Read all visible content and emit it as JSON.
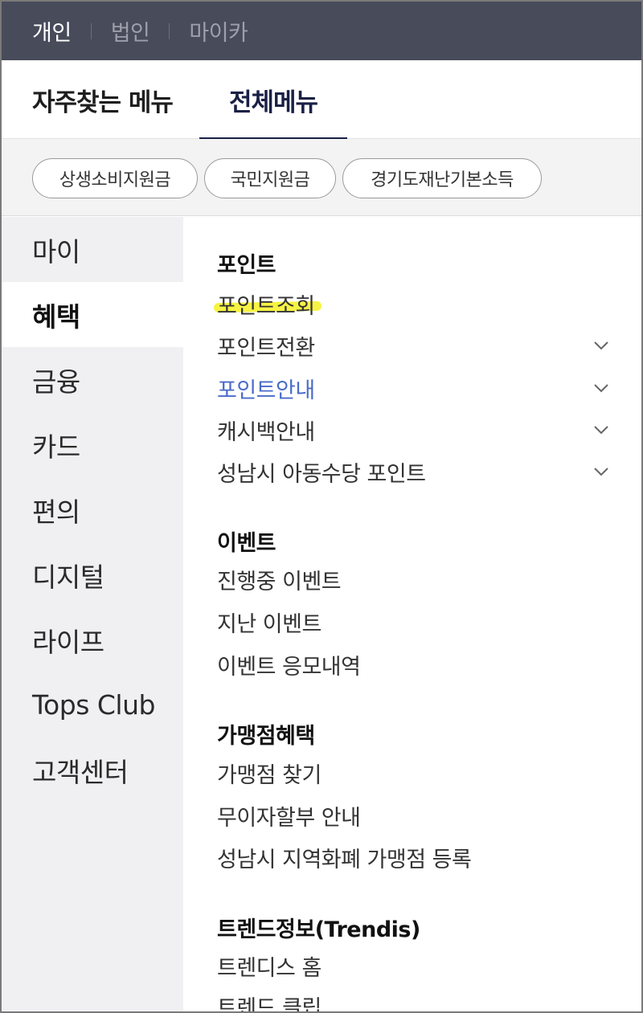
{
  "account_types": [
    {
      "label": "개인",
      "active": true
    },
    {
      "label": "법인",
      "active": false
    },
    {
      "label": "마이카",
      "active": false
    }
  ],
  "tabs": [
    {
      "label": "자주찾는 메뉴",
      "active": false
    },
    {
      "label": "전체메뉴",
      "active": true
    }
  ],
  "chips": [
    "상생소비지원금",
    "국민지원금",
    "경기도재난기본소득"
  ],
  "sidenav": [
    {
      "label": "마이",
      "active": false
    },
    {
      "label": "혜택",
      "active": true
    },
    {
      "label": "금융",
      "active": false
    },
    {
      "label": "카드",
      "active": false
    },
    {
      "label": "편의",
      "active": false
    },
    {
      "label": "디지털",
      "active": false
    },
    {
      "label": "라이프",
      "active": false
    },
    {
      "label": "Tops Club",
      "active": false
    },
    {
      "label": "고객센터",
      "active": false
    }
  ],
  "sections": [
    {
      "title": "포인트",
      "items": [
        {
          "label": "포인트조회",
          "highlighted": true
        },
        {
          "label": "포인트전환",
          "expandable": true,
          "icon": "chevron-down-icon"
        },
        {
          "label": "포인트안내",
          "expandable": true,
          "selected": true,
          "icon": "chevron-down-icon"
        },
        {
          "label": "캐시백안내",
          "expandable": true,
          "icon": "chevron-down-icon"
        },
        {
          "label": "성남시 아동수당 포인트",
          "expandable": true,
          "icon": "chevron-down-icon"
        }
      ]
    },
    {
      "title": "이벤트",
      "items": [
        {
          "label": "진행중 이벤트"
        },
        {
          "label": "지난 이벤트"
        },
        {
          "label": "이벤트 응모내역"
        }
      ]
    },
    {
      "title": "가맹점혜택",
      "items": [
        {
          "label": "가맹점 찾기"
        },
        {
          "label": "무이자할부 안내"
        },
        {
          "label": "성남시 지역화폐 가맹점 등록"
        }
      ]
    },
    {
      "title": "트렌드정보(Trendis)",
      "items": [
        {
          "label": "트렌디스 홈"
        },
        {
          "label": "트렌드 클립"
        }
      ]
    }
  ],
  "colors": {
    "topbar_bg": "#474b5a",
    "active_tab": "#1a2045",
    "selected_link": "#4a6bc9",
    "highlight": "#f5f23a",
    "sidenav_bg": "#f0f0f2"
  }
}
